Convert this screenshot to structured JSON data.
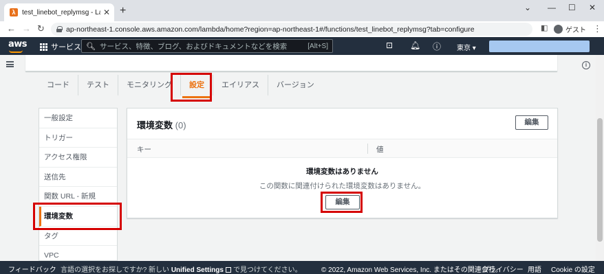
{
  "browser": {
    "tab_title": "test_linebot_replymsg - Lambda",
    "url": "ap-northeast-1.console.aws.amazon.com/lambda/home?region=ap-northeast-1#/functions/test_linebot_replymsg?tab=configure",
    "profile_label": "ゲスト"
  },
  "aws_nav": {
    "logo": "aws",
    "services_label": "サービス",
    "search_placeholder": "サービス、特徴、ブログ、およびドキュメントなどを検索",
    "search_shortcut": "[Alt+S]",
    "region": "東京 ▾"
  },
  "function_tabs": [
    {
      "label": "コード"
    },
    {
      "label": "テスト"
    },
    {
      "label": "モニタリング"
    },
    {
      "label": "設定",
      "active": true
    },
    {
      "label": "エイリアス"
    },
    {
      "label": "バージョン"
    }
  ],
  "side_menu": [
    {
      "label": "一般設定"
    },
    {
      "label": "トリガー"
    },
    {
      "label": "アクセス権限"
    },
    {
      "label": "送信先"
    },
    {
      "label": "関数 URL - 新規"
    },
    {
      "label": "環境変数",
      "active": true
    },
    {
      "label": "タグ"
    },
    {
      "label": "VPC"
    }
  ],
  "env_panel": {
    "title": "環境変数",
    "count": "(0)",
    "edit_label": "編集",
    "col_key": "キー",
    "col_value": "値",
    "empty_title": "環境変数はありません",
    "empty_desc": "この関数に関連付けられた環境変数はありません。",
    "empty_edit_label": "編集"
  },
  "footer": {
    "feedback": "フィードバック",
    "lang_prefix": "言語の選択をお探しですか? 新しい",
    "lang_link": "Unified Settings",
    "lang_suffix": "で見つけてください。",
    "copyright": "© 2022, Amazon Web Services, Inc. またはその関連会社。",
    "privacy": "プライバシー",
    "terms": "用語",
    "cookie": "Cookie の設定"
  },
  "colors": {
    "accent": "#ec7211",
    "highlight": "#d50000",
    "nav_bg": "#232f3e"
  }
}
